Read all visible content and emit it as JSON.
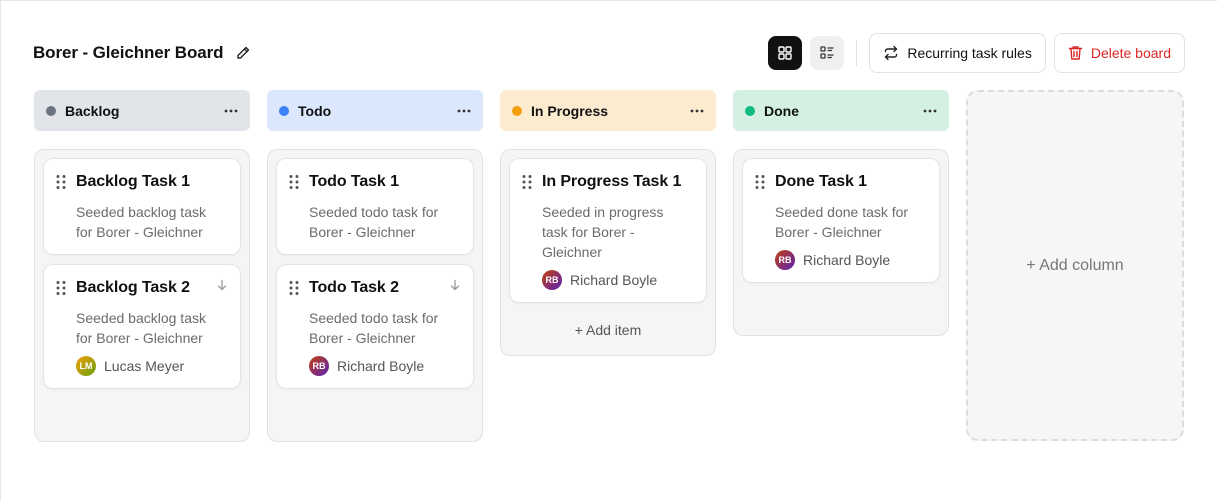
{
  "board": {
    "title": "Borer - Gleichner Board"
  },
  "toolbar": {
    "recurring_label": "Recurring task rules",
    "delete_label": "Delete board"
  },
  "columns": [
    {
      "title": "Backlog",
      "dot_color": "#6b7280",
      "header_bg": "#e1e4e8",
      "cards": [
        {
          "title": "Backlog Task 1",
          "desc": "Seeded backlog task for Borer - Gleichner"
        },
        {
          "title": "Backlog Task 2",
          "desc": "Seeded backlog task for Borer - Gleichner",
          "assignee": "Lucas Meyer",
          "initials": "LM"
        }
      ]
    },
    {
      "title": "Todo",
      "dot_color": "#3b82f6",
      "header_bg": "#dbe7fd",
      "cards": [
        {
          "title": "Todo Task 1",
          "desc": "Seeded todo task for Borer - Gleichner"
        },
        {
          "title": "Todo Task 2",
          "desc": "Seeded todo task for Borer - Gleichner",
          "assignee": "Richard Boyle",
          "initials": "RB"
        }
      ]
    },
    {
      "title": "In Progress",
      "dot_color": "#f59e0b",
      "header_bg": "#fdebd0",
      "cards": [
        {
          "title": "In Progress Task 1",
          "desc": "Seeded in progress task for Borer - Gleichner",
          "assignee": "Richard Boyle",
          "initials": "RB"
        }
      ],
      "add_item": "+ Add item"
    },
    {
      "title": "Done",
      "dot_color": "#10b981",
      "header_bg": "#d3f0e3",
      "cards": [
        {
          "title": "Done Task 1",
          "desc": "Seeded done task for Borer - Gleichner",
          "assignee": "Richard Boyle",
          "initials": "RB"
        }
      ]
    }
  ],
  "add_column_label": "+ Add column",
  "icons": {
    "edit": "pencil-icon",
    "grid_view": "grid-icon",
    "list_view": "list-icon",
    "recurring": "repeat-icon",
    "delete": "trash-icon",
    "column_menu": "more-horizontal-icon",
    "drag": "drag-handle-icon",
    "sort": "arrow-down-icon"
  },
  "colors": {
    "danger": "#dc2626",
    "active_view": "#111111"
  }
}
